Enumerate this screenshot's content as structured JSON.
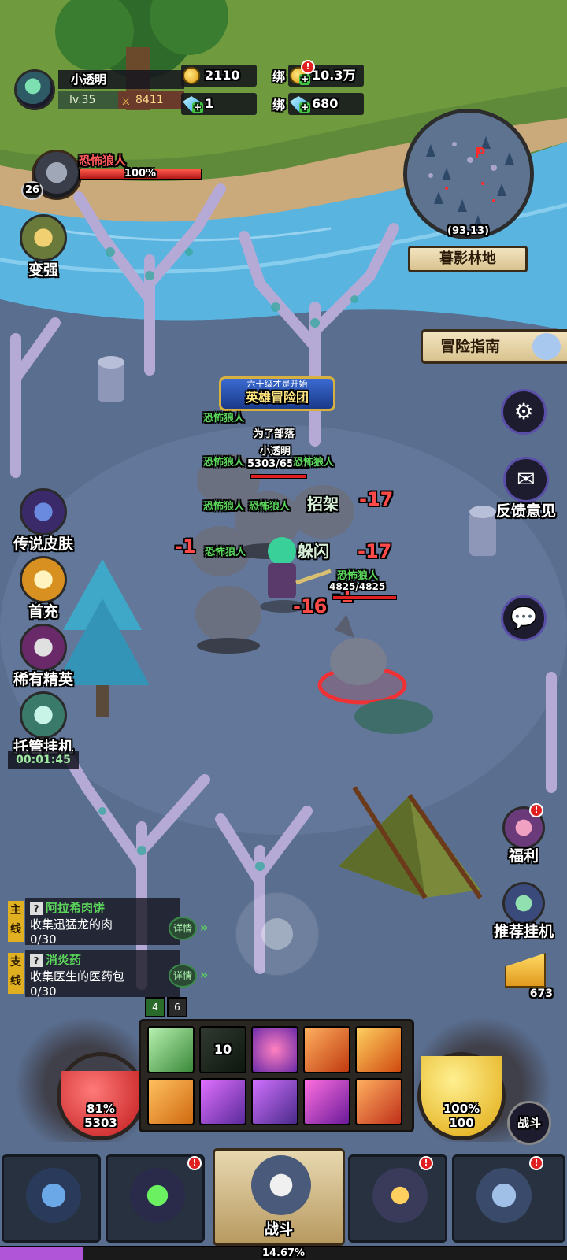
{
  "player": {
    "name": "小透明",
    "level": "lv.35",
    "power": "8411"
  },
  "currency": {
    "gold": "2110",
    "bound_gold_label": "绑",
    "bound_gold": "10.3万",
    "diamond": "1",
    "bound_diamond_label": "绑",
    "bound_diamond": "680",
    "alert": "!"
  },
  "boss": {
    "name": "恐怖狼人",
    "level": "26",
    "hp_percent_text": "100%",
    "hp_fraction": 1.0
  },
  "left_menu": {
    "strengthen": "变强",
    "legend_skin": "传说皮肤",
    "first_recharge": "首充",
    "rare_elite": "稀有精英",
    "auto_idle": "托管挂机",
    "timer": "00:01:45"
  },
  "minimap": {
    "coords": "(93,13)",
    "zone": "暮影林地"
  },
  "right_menu": {
    "guide": "冒险指南",
    "feedback": "反馈意见",
    "welfare": "福利",
    "recommend_idle": "推荐挂机",
    "cheese_count": "673",
    "battle_toggle": "战斗"
  },
  "combat": {
    "event_banner_top": "六十级才是开始",
    "event_banner_main": "英雄冒险团",
    "guild": "为了部落",
    "player_name": "小透明",
    "player_hp": "5303/6532",
    "enemy_name": "恐怖狼人",
    "enemy_hp": "4825/4825",
    "dodge": "躲闪",
    "parry": "招架",
    "damage_numbers": [
      "-17",
      "-16",
      "-17",
      "-1",
      "-1"
    ]
  },
  "quests": [
    {
      "tag": "主线",
      "title": "阿拉希肉饼",
      "desc": "收集迅猛龙的肉",
      "progress": "0/30",
      "detail": "详情"
    },
    {
      "tag": "支线",
      "title": "消炎药",
      "desc": "收集医生的医药包",
      "progress": "0/30",
      "detail": "详情"
    }
  ],
  "buffs": {
    "buff_a": "4",
    "buff_b": "6"
  },
  "skills": {
    "cooldown": "10"
  },
  "orbs": {
    "hp_percent": "81%",
    "hp_value": "5303",
    "hp_fraction": 0.81,
    "mp_percent": "100%",
    "mp_value": "100",
    "mp_fraction": 1.0
  },
  "bottom_nav": {
    "battle": "战斗",
    "alert": "!"
  },
  "exp": {
    "text": "14.67%",
    "fraction": 0.1467
  },
  "colors": {
    "hp_red": "#d8262a",
    "mp_yellow": "#f2c81a",
    "quest_green": "#5bd65b",
    "alert_red": "#e02020"
  }
}
